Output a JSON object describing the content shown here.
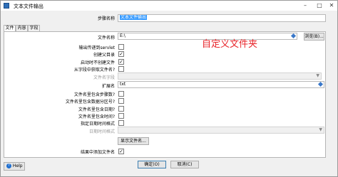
{
  "window": {
    "title": "文本文件输出",
    "step_name_label": "步骤名称",
    "step_name_value": "文本文件输出"
  },
  "tabs": [
    "文件",
    "内容",
    "字段"
  ],
  "form": {
    "filename_label": "文件名称",
    "filename_value": "E:\\",
    "browse_button": "浏览(B)...",
    "output_servlet_label": "输出传递到servlet",
    "create_parent_label": "创建父目录",
    "create_parent_checked": "✓",
    "no_create_at_start_label": "启动时不创建文件",
    "no_create_at_start_checked": "✓",
    "get_filename_from_field_label": "从字段中获取文件名?",
    "filename_field_label": "文件名字段",
    "extension_label": "扩展名",
    "extension_value": "txt",
    "include_stepnr_label": "文件名里包含步骤数?",
    "include_partnr_label": "文件名里包含数据分区号?",
    "include_date_label": "文件名里包含日期?",
    "include_time_label": "文件名里包含时间?",
    "specify_date_format_label": "指定日期时间格式",
    "date_format_label": "日期时间格式",
    "show_filenames_button": "显示文件名...",
    "add_to_result_label": "结果中添加文件名",
    "add_to_result_checked": "✓"
  },
  "annotation": "自定义文件夹",
  "footer": {
    "help_button": "Help",
    "ok_button": "确定(O)",
    "cancel_button": "取消(C)"
  }
}
